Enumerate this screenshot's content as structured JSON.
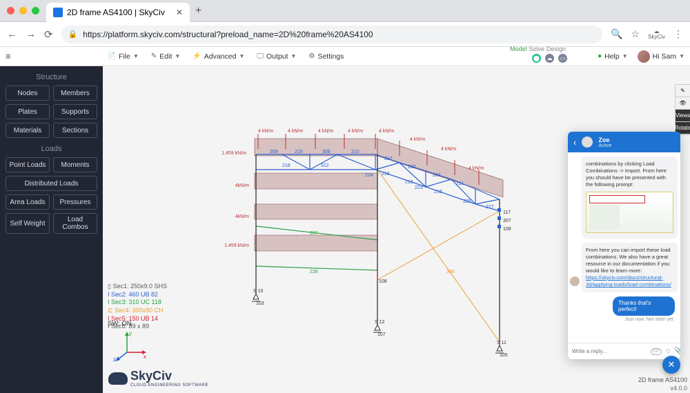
{
  "browser": {
    "tab_title": "2D frame AS4100 | SkyCiv",
    "url": "https://platform.skyciv.com/structural?preload_name=2D%20frame%20AS4100",
    "ext_label": "SkyCiv"
  },
  "toolbar": {
    "file": "File",
    "edit": "Edit",
    "advanced": "Advanced",
    "output": "Output",
    "settings": "Settings",
    "model": "Model",
    "solve": "Solve",
    "design": "Design",
    "help": "Help",
    "user": "Hi Sam"
  },
  "sidebar": {
    "structure_header": "Structure",
    "loads_header": "Loads",
    "nodes": "Nodes",
    "members": "Members",
    "plates": "Plates",
    "supports": "Supports",
    "materials": "Materials",
    "sections": "Sections",
    "point_loads": "Point Loads",
    "moments": "Moments",
    "distributed": "Distributed Loads",
    "area_loads": "Area Loads",
    "pressures": "Pressures",
    "self_weight": "Self Weight",
    "load_combos": "Load Combos"
  },
  "legend": {
    "sec1": "Sec1: 250x9.0 SHS",
    "sec2": "Sec2: 460 UB 82",
    "sec3": "Sec3: 310 UC 118",
    "sec4": "Sec4: 300x90 CH",
    "sec5": "Sec5: 150 UB 14",
    "sec6": "Sec6: 89 x 89",
    "sw": "SW: ON"
  },
  "distributed_label": "4 kN/m",
  "point_load_label": "1.459 kN/m",
  "footer": {
    "logo": "SkyCiv",
    "sub": "CLOUD ENGINEERING SOFTWARE",
    "version": "v4.0.0",
    "filename": "2D frame AS4100"
  },
  "toolstrip": {
    "views": "Views",
    "rotate": "Rotate"
  },
  "chat": {
    "name": "Zoe",
    "status": "Active",
    "msg1": "combinations by clicking Load Combinations -> Import. From here you should have be presented with the following prompt:",
    "msg2a": "From here you can import these load combinations. We also have a great resource in our documentation if you would like to learn more:",
    "msg2b": "https://skyciv.com/docs/structural-3d/applying-loads/load-combinations/",
    "reply": "Thanks that's perfect!",
    "meta": "Just now. Not seen yet",
    "placeholder": "Write a reply..."
  },
  "node_labels": {
    "s10": "S 10",
    "n103": "103",
    "s12": "S 12",
    "n107": "107",
    "s11": "S 11",
    "n105": "105",
    "n117": "117",
    "n307": "307",
    "n108": "108",
    "member237": "237",
    "member228": "228",
    "member348": "348",
    "truss": [
      "209",
      "215",
      "308",
      "210",
      "217",
      "222",
      "204",
      "211",
      "218",
      "312",
      "224",
      "213",
      "219",
      "225",
      "227",
      "216",
      "223"
    ]
  }
}
